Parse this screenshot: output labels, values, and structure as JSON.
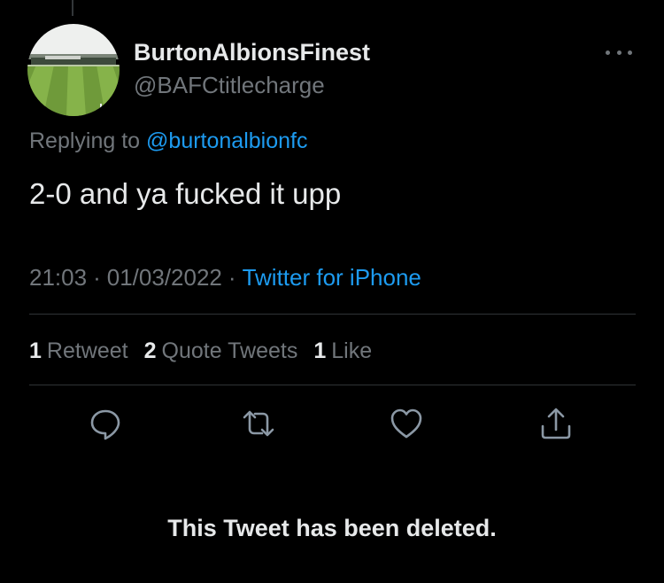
{
  "tweet": {
    "display_name": "BurtonAlbionsFinest",
    "handle": "@BAFCtitlecharge",
    "replying_prefix": "Replying to",
    "replying_to": "@burtonalbionfc",
    "text": "2-0 and ya fucked it upp",
    "time": "21:03",
    "date": "01/03/2022",
    "separator": "·",
    "source": "Twitter for iPhone"
  },
  "stats": [
    {
      "count": "1",
      "label": "Retweet"
    },
    {
      "count": "2",
      "label": "Quote Tweets"
    },
    {
      "count": "1",
      "label": "Like"
    }
  ],
  "actions": {
    "reply_icon": "reply-icon",
    "retweet_icon": "retweet-icon",
    "like_icon": "heart-icon",
    "share_icon": "share-icon"
  },
  "deleted_notice": "This Tweet has been deleted.",
  "colors": {
    "background": "#000000",
    "primary_text": "#e7e9ea",
    "secondary_text": "#71767b",
    "link": "#1d9bf0",
    "divider": "#2f3336"
  }
}
